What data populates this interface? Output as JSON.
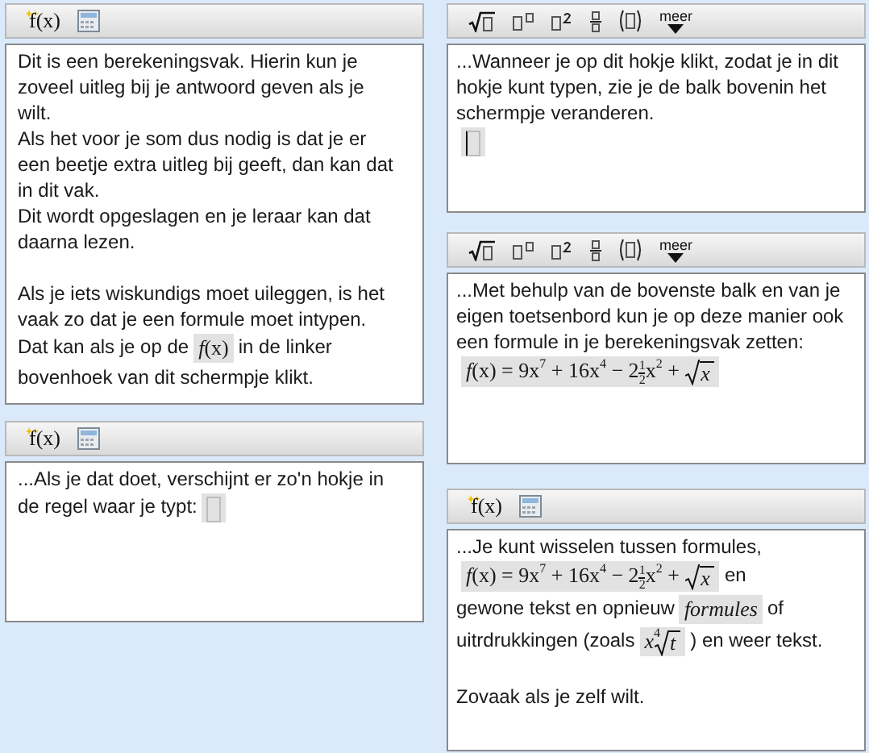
{
  "columns": [
    {
      "panels": [
        {
          "toolbar": [
            {
              "kind": "formula",
              "label": "f(x)"
            },
            {
              "kind": "calculator"
            }
          ],
          "paragraphs": [
            {
              "kind": "text",
              "segments": [
                {
                  "kind": "text",
                  "text": "Dit is een berekeningsvak. Hierin kun je zoveel uitleg bij je antwoord geven als je wilt."
                }
              ]
            },
            {
              "kind": "text",
              "segments": [
                {
                  "kind": "text",
                  "text": "Als het voor je som dus nodig is dat je er een beetje extra uitleg bij geeft, dan kan dat in dit vak."
                }
              ]
            },
            {
              "kind": "text",
              "segments": [
                {
                  "kind": "text",
                  "text": "Dit wordt opgeslagen en je leraar kan dat daarna lezen."
                }
              ]
            },
            {
              "kind": "blank"
            },
            {
              "kind": "text",
              "segments": [
                {
                  "kind": "text",
                  "text": "Als je iets wiskundigs moet uileggen, is het vaak zo dat je een formule moet intypen."
                }
              ]
            },
            {
              "kind": "text",
              "segments": [
                {
                  "kind": "text",
                  "text": "Dat kan als je op de"
                },
                {
                  "kind": "formula",
                  "tokens": [
                    {
                      "kind": "i",
                      "text": "f"
                    },
                    {
                      "kind": "t",
                      "text": "(x)"
                    }
                  ]
                },
                {
                  "kind": "text",
                  "text": "in de linker"
                },
                {
                  "kind": "break"
                },
                {
                  "kind": "text",
                  "text": "bovenhoek van dit schermpje klikt."
                }
              ]
            }
          ]
        },
        {
          "toolbar": [
            {
              "kind": "formula",
              "label": "f(x)"
            },
            {
              "kind": "calculator"
            }
          ],
          "paragraphs": [
            {
              "kind": "text",
              "segments": [
                {
                  "kind": "text",
                  "text": "...Als je dat doet, verschijnt er zo'n hokje in"
                },
                {
                  "kind": "break"
                },
                {
                  "kind": "text",
                  "text": "de regel waar je typt:"
                },
                {
                  "kind": "formula",
                  "tokens": [
                    {
                      "kind": "slot",
                      "cursor": false
                    }
                  ]
                }
              ]
            }
          ]
        }
      ]
    },
    {
      "panels": [
        {
          "toolbar": [
            {
              "kind": "sqrt"
            },
            {
              "kind": "power0"
            },
            {
              "kind": "power2"
            },
            {
              "kind": "fraction"
            },
            {
              "kind": "parens"
            },
            {
              "kind": "more",
              "label": "meer"
            }
          ],
          "paragraphs": [
            {
              "kind": "text",
              "segments": [
                {
                  "kind": "text",
                  "text": "...Wanneer je op dit hokje klikt, zodat je in dit hokje kunt typen, zie je de balk bovenin het schermpje veranderen."
                }
              ]
            },
            {
              "kind": "text",
              "segments": [
                {
                  "kind": "formula",
                  "tokens": [
                    {
                      "kind": "slot",
                      "cursor": true
                    }
                  ]
                }
              ]
            }
          ]
        },
        {
          "toolbar": [
            {
              "kind": "sqrt"
            },
            {
              "kind": "power0"
            },
            {
              "kind": "power2"
            },
            {
              "kind": "fraction"
            },
            {
              "kind": "parens"
            },
            {
              "kind": "more",
              "label": "meer"
            }
          ],
          "paragraphs": [
            {
              "kind": "text",
              "segments": [
                {
                  "kind": "text",
                  "text": "...Met behulp van de bovenste balk en van je eigen toetsenbord kun je op deze manier ook een formule in je berekeningsvak zetten:"
                }
              ]
            },
            {
              "kind": "text",
              "segments": [
                {
                  "kind": "formula",
                  "tokens": [
                    {
                      "kind": "i",
                      "text": "f"
                    },
                    {
                      "kind": "t",
                      "text": "(x) = 9x"
                    },
                    {
                      "kind": "sup",
                      "text": "7"
                    },
                    {
                      "kind": "t",
                      "text": " + 16x"
                    },
                    {
                      "kind": "sup",
                      "text": "4"
                    },
                    {
                      "kind": "t",
                      "text": " − 2"
                    },
                    {
                      "kind": "frac",
                      "num": "1",
                      "den": "2"
                    },
                    {
                      "kind": "t",
                      "text": "x"
                    },
                    {
                      "kind": "sup",
                      "text": "2"
                    },
                    {
                      "kind": "t",
                      "text": " + "
                    },
                    {
                      "kind": "sqrt",
                      "text": "x"
                    }
                  ]
                }
              ]
            }
          ]
        },
        {
          "toolbar": [
            {
              "kind": "formula",
              "label": "f(x)"
            },
            {
              "kind": "calculator"
            }
          ],
          "paragraphs": [
            {
              "kind": "text",
              "segments": [
                {
                  "kind": "text",
                  "text": "...Je kunt wisselen tussen formules,"
                },
                {
                  "kind": "break"
                },
                {
                  "kind": "formula",
                  "tokens": [
                    {
                      "kind": "i",
                      "text": "f"
                    },
                    {
                      "kind": "t",
                      "text": "(x) = 9x"
                    },
                    {
                      "kind": "sup",
                      "text": "7"
                    },
                    {
                      "kind": "t",
                      "text": " + 16x"
                    },
                    {
                      "kind": "sup",
                      "text": "4"
                    },
                    {
                      "kind": "t",
                      "text": " − 2"
                    },
                    {
                      "kind": "frac",
                      "num": "1",
                      "den": "2"
                    },
                    {
                      "kind": "t",
                      "text": "x"
                    },
                    {
                      "kind": "sup",
                      "text": "2"
                    },
                    {
                      "kind": "t",
                      "text": " + "
                    },
                    {
                      "kind": "sqrt",
                      "text": "x"
                    }
                  ]
                },
                {
                  "kind": "text",
                  "text": "en"
                },
                {
                  "kind": "break"
                },
                {
                  "kind": "text",
                  "text": "gewone tekst en opnieuw"
                },
                {
                  "kind": "formula",
                  "tokens": [
                    {
                      "kind": "i",
                      "text": "formules"
                    }
                  ]
                },
                {
                  "kind": "text",
                  "text": "of"
                },
                {
                  "kind": "break"
                },
                {
                  "kind": "text",
                  "text": "uitrdrukkingen (zoals"
                },
                {
                  "kind": "formula",
                  "tokens": [
                    {
                      "kind": "i",
                      "text": "x"
                    },
                    {
                      "kind": "sqrt",
                      "root": "4",
                      "text": "t"
                    }
                  ]
                },
                {
                  "kind": "text",
                  "text": ") en weer tekst."
                }
              ]
            },
            {
              "kind": "blank"
            },
            {
              "kind": "text",
              "segments": [
                {
                  "kind": "text",
                  "text": "Zovaak als je zelf wilt."
                }
              ]
            }
          ]
        }
      ]
    }
  ]
}
